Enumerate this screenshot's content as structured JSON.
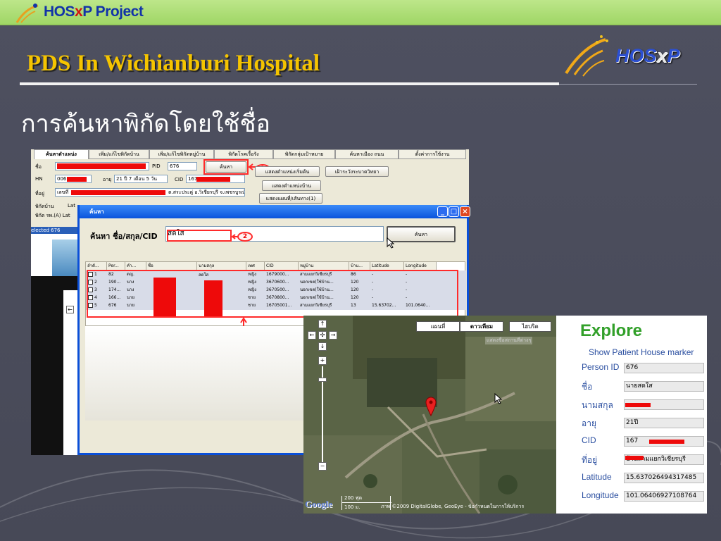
{
  "header": {
    "brand_prefix": "HOS",
    "brand_x": "x",
    "brand_suffix": "P Project"
  },
  "slide": {
    "title": "PDS In Wichianburi Hospital",
    "subheading": "การค้นหาพิกัดโดยใช้ชื่อ"
  },
  "logo": {
    "prefix": "HOS",
    "x": "x",
    "suffix": "P"
  },
  "main_window": {
    "tabs": [
      "ค้นหาตำแหน่ง",
      "เพิ่ม/แก้ไขพิกัดบ้าน",
      "เพิ่ม/แก้ไขพิกัดหมู่บ้าน",
      "พิกัดโรคเรื้อรัง",
      "พิกัดกลุ่มเป้าหมาย",
      "ค้นหาเมือง ถนน",
      "ตั้งค่าการใช้งาน"
    ],
    "name_label": "ชื่อ",
    "pid_label": "PID",
    "pid_value": "676",
    "search_btn": "ค้นหา",
    "hn_label": "HN",
    "hn_value": "006",
    "age_label": "อายุ",
    "age_value": "21 ปี 7 เดือน 5 วัน",
    "cid_label": "CID",
    "cid_value": "167",
    "address_label": "ที่อยู่",
    "address_prefix": "เลขที่",
    "address_value": "ต.สระประดู่ อ.วิเชียรบุรี จ.เพชรบูรณ์",
    "home_coord_label": "พิกัดบ้าน",
    "lat_short": "Lat",
    "hosp_coord_label": "พิกัด รพ.(A) Lat",
    "btn_show_start": "แสดงตำแหน่งเริ่มต้น",
    "btn_show_house": "แสดงตำแหน่งบ้าน",
    "btn_show_route": "แสดงแผนที่/เส้นทาง(1)",
    "btn_surveillance": "เฝ้าระวังระบาดวิทยา",
    "selected_text": "elected 676"
  },
  "dialog": {
    "title": "ค้นหา",
    "search_label": "ค้นหา ชื่อ/สกุล/CID",
    "search_value": "สดใส",
    "search_btn": "ค้นหา",
    "columns": [
      "ลำดั...",
      "Per...",
      "คำ...",
      "ชื่อ",
      "นามสกุล",
      "เพศ",
      "CID",
      "หมู่บ้าน",
      "บ้าน...",
      "Latitude",
      "Longitude"
    ],
    "rows": [
      [
        "1",
        "82",
        "ดญ.",
        "",
        "",
        "หญิง",
        "1679000...",
        "สามแยกวิเชียรบุรี",
        "86",
        "-",
        "-"
      ],
      [
        "2",
        "190...",
        "นาง",
        "",
        "",
        "หญิง",
        "3670600...",
        "นอกเขต(ใช้บ้าน...",
        "120",
        "-",
        "-"
      ],
      [
        "3",
        "174...",
        "นาง",
        "",
        "",
        "หญิง",
        "3670500...",
        "นอกเขต(ใช้บ้าน...",
        "120",
        "-",
        "-"
      ],
      [
        "4",
        "166...",
        "นาย",
        "",
        "",
        "ชาย",
        "3670800...",
        "นอกเขต(ใช้บ้าน...",
        "120",
        "-",
        "-"
      ],
      [
        "5",
        "676",
        "นาย",
        "",
        "",
        "ชาย",
        "16705001...",
        "สามแยกวิเชียรบุรี",
        "13",
        "15.63702...",
        "101.0640..."
      ]
    ],
    "row1_name_partial": "สดใส"
  },
  "callouts": {
    "c1": "1",
    "c2": "2",
    "c3": "3"
  },
  "map": {
    "types": [
      "แผนที่",
      "ดาวเทียม",
      "ไฮบริด"
    ],
    "active_type": "ดาวเทียม",
    "overlay_text": "แสดงชื่อสถานที่ต่างๆ",
    "scale_ft": "200 ฟุต",
    "scale_m": "100 ม.",
    "copyright": "ภาพ ©2009 DigitalGlobe, GeoEye - ข้อกำหนดในการให้บริการ",
    "google": "Google"
  },
  "explore": {
    "title": "Explore",
    "subtitle": "Show Patient House marker",
    "fields": [
      {
        "label": "Person ID",
        "value": "676"
      },
      {
        "label": "ชื่อ",
        "value": "นายสดใส"
      },
      {
        "label": "นามสกุล",
        "value": ""
      },
      {
        "label": "อายุ",
        "value": "21ปี"
      },
      {
        "label": "CID",
        "value": "167"
      },
      {
        "label": "ที่อยู่",
        "value": "บ้านสามแยกวิเชียรบุรี"
      },
      {
        "label": "Latitude",
        "value": "15.637026494317485"
      },
      {
        "label": "Longitude",
        "value": "101.06406927108764"
      }
    ]
  },
  "colors": {
    "accent_title": "#f5c400",
    "redaction": "#ee0a0a",
    "brand_blue": "#1233a8",
    "xp_blue": "#0a54dc"
  }
}
